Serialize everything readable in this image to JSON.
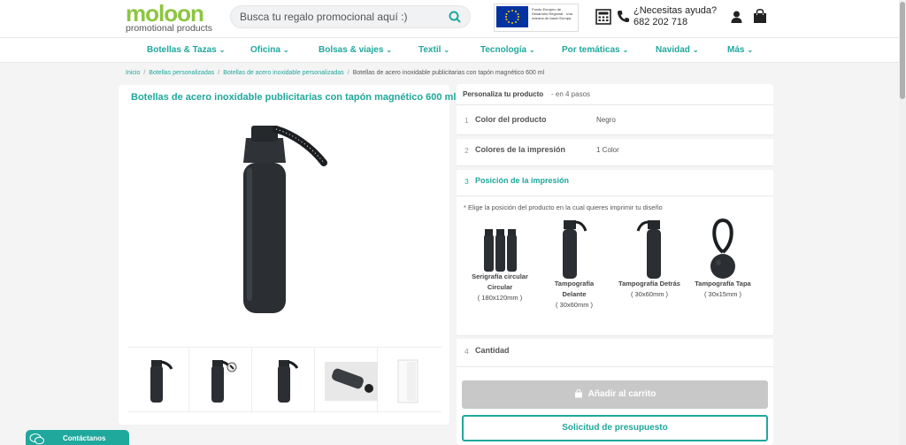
{
  "header": {
    "logo_main": "moloon",
    "logo_sub": "promotional products",
    "search_placeholder": "Busca tu regalo promocional aquí :)",
    "eu_text": "Fondo Europeo de Desarrollo Regional · Una manera de hacer Europa",
    "help_question": "¿Necesitas ayuda?",
    "help_phone": "682 202 718",
    "icons": [
      "search-icon",
      "calculator-icon",
      "phone-icon",
      "user-icon",
      "shopping-bag-icon"
    ]
  },
  "nav": {
    "items": [
      {
        "label": "Botellas & Tazas"
      },
      {
        "label": "Oficina"
      },
      {
        "label": "Bolsas & viajes"
      },
      {
        "label": "Textil"
      },
      {
        "label": "Tecnología"
      },
      {
        "label": "Por temáticas"
      },
      {
        "label": "Navidad"
      },
      {
        "label": "Más"
      }
    ]
  },
  "breadcrumb": {
    "items": [
      "Inicio",
      "Botellas personalizadas",
      "Botellas de acero inoxidable personalizadas"
    ],
    "current": "Botellas de acero inoxidable publicitarias con tapón magnético 600 ml"
  },
  "product": {
    "title": "Botellas de acero inoxidable publicitarias con tapón magnético 600 ml",
    "thumbnail_count": 5
  },
  "config": {
    "title": "Personaliza tu producto",
    "subtitle": "- en 4 pasos",
    "steps": [
      {
        "num": "1",
        "label": "Color del producto",
        "value": "Negro"
      },
      {
        "num": "2",
        "label": "Colores de la impresión",
        "value": "1 Color"
      },
      {
        "num": "3",
        "label": "Posición de la impresión",
        "value": ""
      },
      {
        "num": "4",
        "label": "Cantidad",
        "value": ""
      }
    ],
    "hint": "* Elige la posición del producto en la cual quieres imprimir tu diseño",
    "options": [
      {
        "name": "Serigrafía circular Circular",
        "size": "( 180x120mm )"
      },
      {
        "name": "Tampografía Delante",
        "size": "( 30x60mm )"
      },
      {
        "name": "Tampografía Detrás",
        "size": "( 30x60mm )"
      },
      {
        "name": "Tampografía Tapa",
        "size": "( 30x15mm )"
      }
    ],
    "cart_label": "Añadir al carrito",
    "quote_label": "Solicitud de presupuesto"
  },
  "contact": {
    "label": "Contáctanos"
  },
  "colors": {
    "brand_teal": "#1fa89c",
    "brand_green": "#8cc63f",
    "disabled_gray": "#c8c8c8"
  }
}
